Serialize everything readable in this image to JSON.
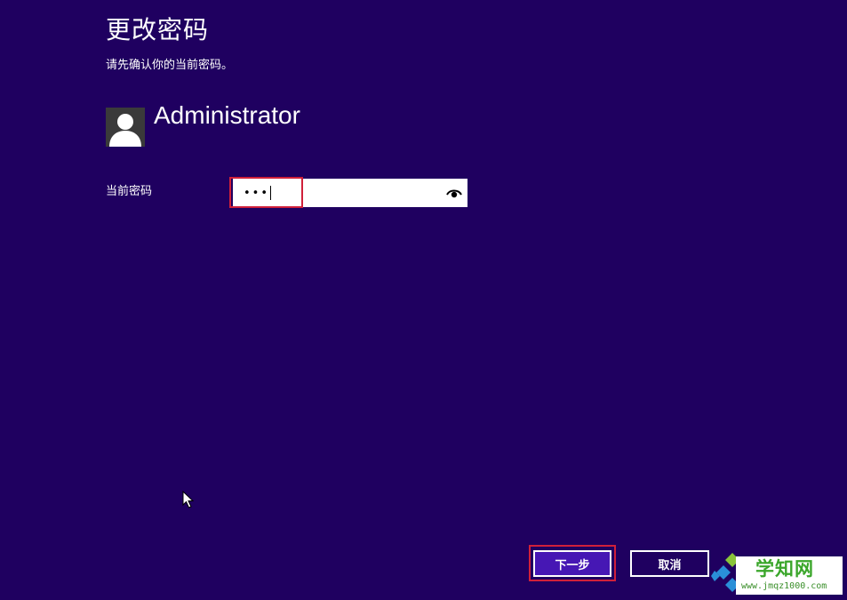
{
  "dialog": {
    "title": "更改密码",
    "subtitle": "请先确认你的当前密码。"
  },
  "user": {
    "name": "Administrator",
    "avatar_icon": "user-silhouette-icon"
  },
  "password_field": {
    "label": "当前密码",
    "masked_value": "•••",
    "reveal_icon": "eye-icon"
  },
  "buttons": {
    "next_label": "下一步",
    "cancel_label": "取消"
  },
  "watermark": {
    "title": "学知网",
    "url": "www.jmqz1000.com"
  },
  "colors": {
    "background": "#1f0060",
    "next_button": "#4617b4",
    "highlight": "#d0203a",
    "watermark_green": "#3aa62a"
  }
}
